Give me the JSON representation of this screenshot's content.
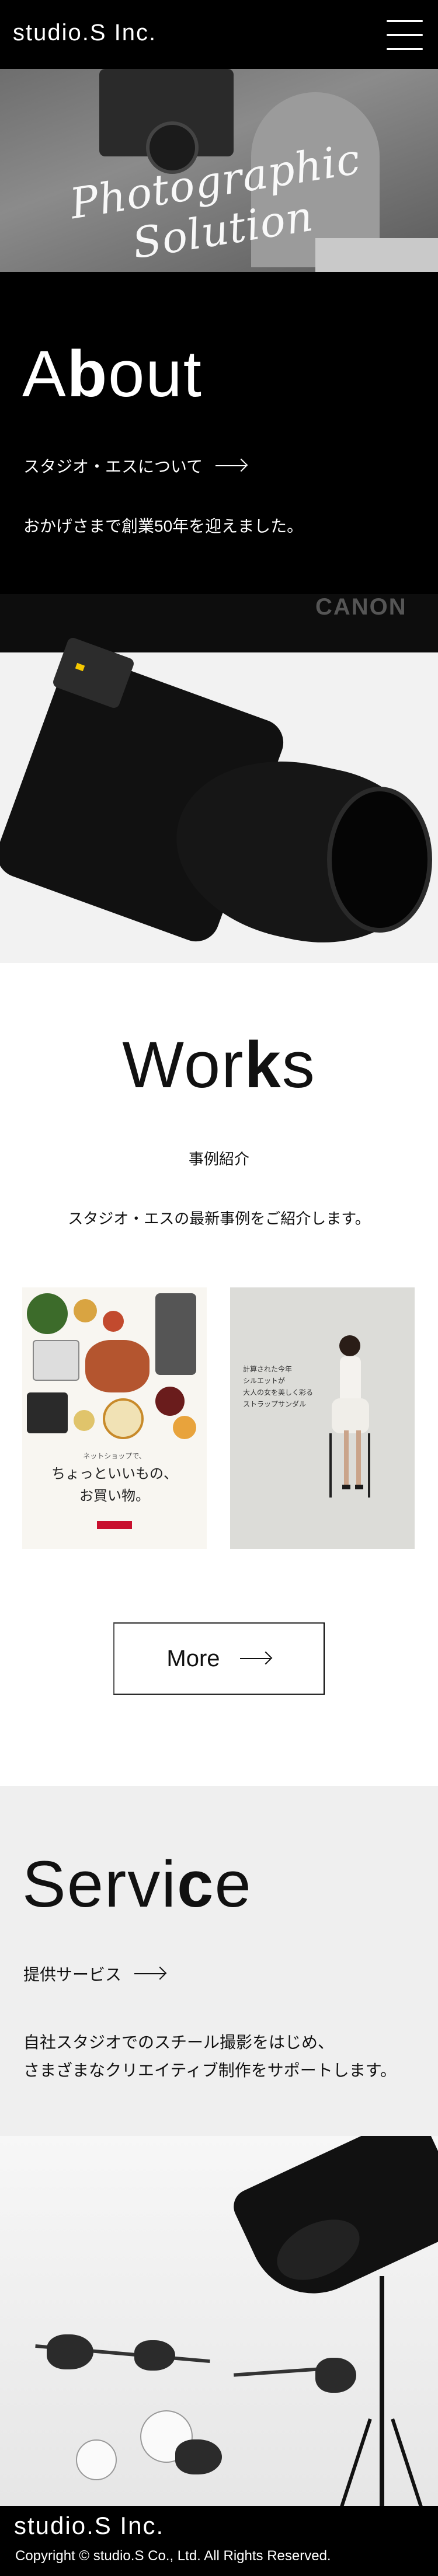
{
  "header": {
    "logo": "studio.S Inc."
  },
  "hero": {
    "script_text": "Photographic Solution"
  },
  "about": {
    "title_prefix": "A",
    "title_bold": "b",
    "title_suffix": "out",
    "link_label": "スタジオ・エスについて",
    "description": "おかげさまで創業50年を迎えました。"
  },
  "camera_photo": {
    "brand_text": "CANON"
  },
  "works": {
    "title_prefix": "Wor",
    "title_bold": "k",
    "title_suffix": "s",
    "subtitle": "事例紹介",
    "description": "スタジオ・エスの最新事例をご紹介します。",
    "card1": {
      "kicker": "ネットショップで、",
      "line1": "ちょっといいもの、",
      "line2": "お買い物。"
    },
    "card2": {
      "copy_line1": "計算された今年",
      "copy_line2": "シルエットが",
      "copy_line3": "大人の女を美しく彩る",
      "copy_line4": "ストラップサンダル"
    },
    "more_label": "More"
  },
  "service": {
    "title_prefix": "Servi",
    "title_bold": "c",
    "title_suffix": "e",
    "link_label": "提供サービス",
    "description_line1": "自社スタジオでのスチール撮影をはじめ、",
    "description_line2": "さまざまなクリエイティブ制作をサポートします。"
  },
  "footer": {
    "logo": "studio.S Inc.",
    "copyright": "Copyright © studio.S Co., Ltd. All Rights Reserved."
  },
  "colors": {
    "black": "#000000",
    "service_bg": "#efefef",
    "text": "#111111"
  },
  "icons": {
    "menu": "hamburger-icon",
    "arrow": "arrow-right-icon"
  }
}
